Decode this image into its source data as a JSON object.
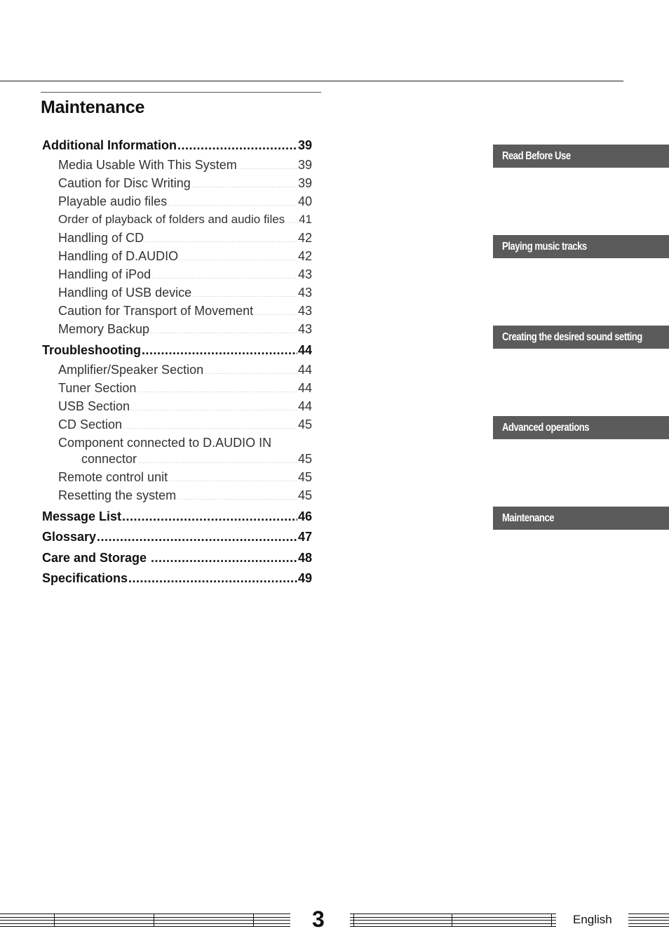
{
  "page": {
    "title": "Maintenance",
    "page_number": "3",
    "language": "English"
  },
  "toc": {
    "sections": [
      {
        "label": "Additional Information",
        "page": "39",
        "items": [
          {
            "label": "Media Usable With This System",
            "page": "39"
          },
          {
            "label": "Caution for Disc Writing",
            "page": "39"
          },
          {
            "label": "Playable audio files",
            "page": "40"
          },
          {
            "label": "Order of playback of folders and audio files",
            "page": "41"
          },
          {
            "label": "Handling of CD",
            "page": "42"
          },
          {
            "label": "Handling of D.AUDIO",
            "page": "42"
          },
          {
            "label": "Handling of iPod",
            "page": "43"
          },
          {
            "label": "Handling of USB device",
            "page": "43"
          },
          {
            "label": "Caution for Transport of Movement",
            "page": "43"
          },
          {
            "label": "Memory Backup",
            "page": "43"
          }
        ]
      },
      {
        "label": "Troubleshooting",
        "page": "44",
        "items": [
          {
            "label": "Amplifier/Speaker Section",
            "page": "44"
          },
          {
            "label": "Tuner Section",
            "page": "44"
          },
          {
            "label": "USB Section",
            "page": "44"
          },
          {
            "label": "CD Section",
            "page": "45"
          },
          {
            "label_line1": "Component connected to D.AUDIO IN",
            "label_line2": "connector",
            "page": "45"
          },
          {
            "label": "Remote control unit",
            "page": "45"
          },
          {
            "label": "Resetting the system",
            "page": "45"
          }
        ]
      },
      {
        "label": "Message List",
        "page": "46"
      },
      {
        "label": "Glossary",
        "page": "47"
      },
      {
        "label": "Care and Storage",
        "page": "48"
      },
      {
        "label": "Specifications",
        "page": "49"
      }
    ]
  },
  "chapter_tabs": [
    {
      "label": "Read Before Use",
      "active": false
    },
    {
      "label": "Playing music tracks",
      "active": false
    },
    {
      "label": "Creating the desired sound setting",
      "active": false
    },
    {
      "label": "Advanced operations",
      "active": false
    },
    {
      "label": "Maintenance",
      "active": true
    }
  ],
  "colors": {
    "tab_background": "#5b5b5b",
    "tab_text": "#ffffff",
    "text": "#111111"
  }
}
